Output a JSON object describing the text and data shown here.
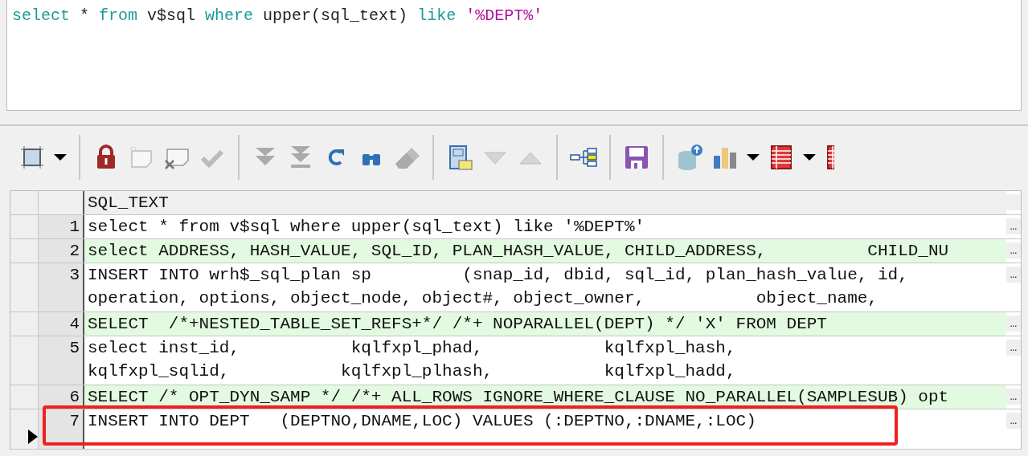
{
  "editor": {
    "tokens": [
      {
        "text": "select",
        "kind": "keyword"
      },
      {
        "text": " * ",
        "kind": "plain"
      },
      {
        "text": "from",
        "kind": "keyword"
      },
      {
        "text": " v$sql ",
        "kind": "plain"
      },
      {
        "text": "where",
        "kind": "keyword"
      },
      {
        "text": " upper(sql_text) ",
        "kind": "plain"
      },
      {
        "text": "like ",
        "kind": "keyword"
      },
      {
        "text": "'%DEPT%'",
        "kind": "string"
      }
    ]
  },
  "grid": {
    "columns": [
      "SQL_TEXT"
    ],
    "rows": [
      {
        "number": "1",
        "lines": [
          "select * from v$sql where upper(sql_text) like '%DEPT%'"
        ],
        "shaded": false,
        "current": false,
        "boxed": false,
        "more": "…"
      },
      {
        "number": "2",
        "lines": [
          "select ADDRESS, HASH_VALUE, SQL_ID, PLAN_HASH_VALUE, CHILD_ADDRESS,          CHILD_NU"
        ],
        "shaded": true,
        "current": false,
        "boxed": false,
        "more": "…"
      },
      {
        "number": "3",
        "lines": [
          "INSERT INTO wrh$_sql_plan sp         (snap_id, dbid, sql_id, plan_hash_value, id,",
          "operation, options, object_node, object#, object_owner,           object_name,"
        ],
        "shaded": false,
        "current": false,
        "boxed": false,
        "more": "…"
      },
      {
        "number": "4",
        "lines": [
          "SELECT  /*+NESTED_TABLE_SET_REFS+*/ /*+ NOPARALLEL(DEPT) */ 'X' FROM DEPT"
        ],
        "shaded": true,
        "current": false,
        "boxed": false,
        "more": "…"
      },
      {
        "number": "5",
        "lines": [
          "select inst_id,           kqlfxpl_phad,            kqlfxpl_hash,",
          "kqlfxpl_sqlid,           kqlfxpl_plhash,           kqlfxpl_hadd,"
        ],
        "shaded": false,
        "current": false,
        "boxed": false,
        "more": "…"
      },
      {
        "number": "6",
        "lines": [
          "SELECT /* OPT_DYN_SAMP */ /*+ ALL_ROWS IGNORE_WHERE_CLAUSE NO_PARALLEL(SAMPLESUB) opt"
        ],
        "shaded": true,
        "current": false,
        "boxed": false,
        "more": "…"
      },
      {
        "number": "7",
        "lines": [
          "INSERT INTO DEPT   (DEPTNO,DNAME,LOC) VALUES (:DEPTNO,:DNAME,:LOC)"
        ],
        "shaded": false,
        "current": true,
        "boxed": true,
        "more": "…"
      }
    ]
  }
}
